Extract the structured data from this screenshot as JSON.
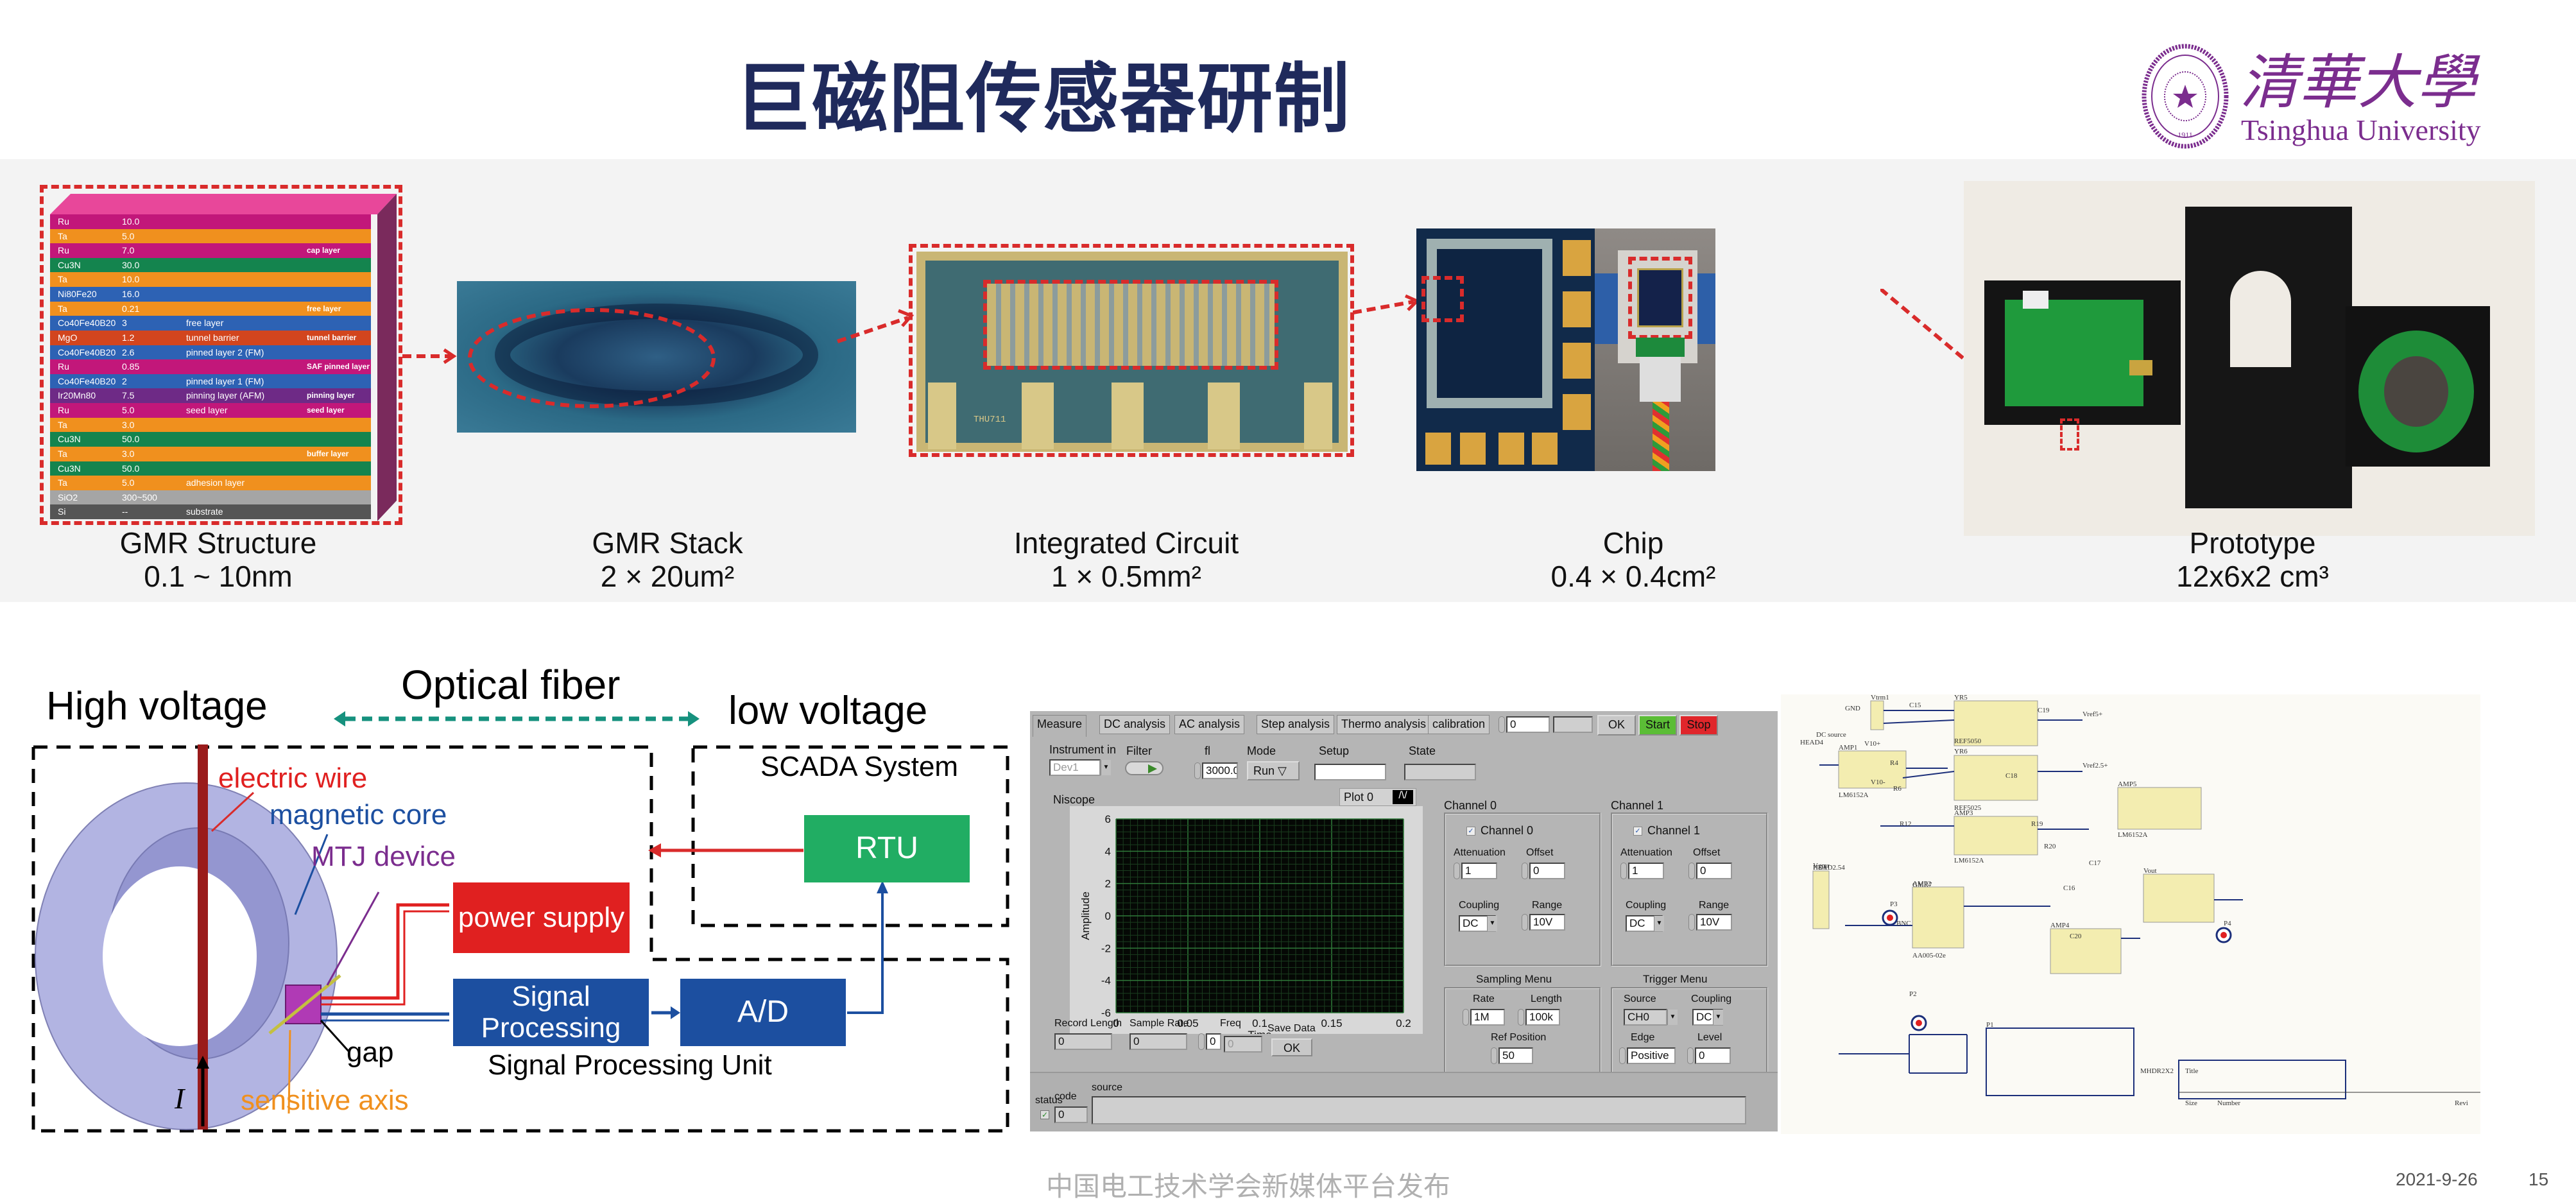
{
  "slide": {
    "title": "巨磁阻传感器研制",
    "logo": {
      "name_cn": "清華大學",
      "name_en": "Tsinghua University",
      "seal_year": "1911",
      "seal_text": "TSINGHUA UNIVERSITY"
    },
    "brand_color": "#1f2a5c",
    "logo_color": "#7b2d8e",
    "accent_red": "#d92b2b",
    "footer": "中国电工技术学会新媒体平台发布",
    "date": "2021-9-26",
    "page_number": "15"
  },
  "gmr_structure": {
    "layers": [
      {
        "material": "Ru",
        "thickness": "10.0",
        "desc": "",
        "color": "#c2177a"
      },
      {
        "material": "Ta",
        "thickness": "5.0",
        "desc": "",
        "color": "#f0901e"
      },
      {
        "material": "Ru",
        "thickness": "7.0",
        "desc": "",
        "color": "#c2177a"
      },
      {
        "material": "Cu3N",
        "thickness": "30.0",
        "desc": "",
        "color": "#14844e"
      },
      {
        "material": "Ta",
        "thickness": "10.0",
        "desc": "",
        "color": "#f0901e"
      },
      {
        "material": "Ni80Fe20",
        "thickness": "16.0",
        "desc": "",
        "color": "#2d62b4"
      },
      {
        "material": "Ta",
        "thickness": "0.21",
        "desc": "",
        "color": "#f0901e"
      },
      {
        "material": "Co40Fe40B20",
        "thickness": "3",
        "desc": "free layer",
        "color": "#2d62b4"
      },
      {
        "material": "MgO",
        "thickness": "1.2",
        "desc": "tunnel barrier",
        "color": "#d2451e"
      },
      {
        "material": "Co40Fe40B20",
        "thickness": "2.6",
        "desc": "pinned layer 2 (FM)",
        "color": "#2d62b4"
      },
      {
        "material": "Ru",
        "thickness": "0.85",
        "desc": "",
        "color": "#c2177a"
      },
      {
        "material": "Co40Fe40B20",
        "thickness": "2",
        "desc": "pinned layer 1 (FM)",
        "color": "#2d62b4"
      },
      {
        "material": "Ir20Mn80",
        "thickness": "7.5",
        "desc": "pinning layer (AFM)",
        "color": "#6e2a86"
      },
      {
        "material": "Ru",
        "thickness": "5.0",
        "desc": "seed layer",
        "color": "#c2177a"
      },
      {
        "material": "Ta",
        "thickness": "3.0",
        "desc": "",
        "color": "#f0901e"
      },
      {
        "material": "Cu3N",
        "thickness": "50.0",
        "desc": "",
        "color": "#14844e"
      },
      {
        "material": "Ta",
        "thickness": "3.0",
        "desc": "",
        "color": "#f0901e"
      },
      {
        "material": "Cu3N",
        "thickness": "50.0",
        "desc": "",
        "color": "#14844e"
      },
      {
        "material": "Ta",
        "thickness": "5.0",
        "desc": "adhesion layer",
        "color": "#f0901e"
      },
      {
        "material": "SiO2",
        "thickness": "300~500",
        "desc": "",
        "color": "#a5a5a5"
      },
      {
        "material": "Si",
        "thickness": "--",
        "desc": "substrate",
        "color": "#555555"
      }
    ],
    "groups": [
      {
        "label": "cap layer",
        "row": 2
      },
      {
        "label": "free layer",
        "row": 6
      },
      {
        "label": "tunnel barrier",
        "row": 8
      },
      {
        "label": "SAF pinned layer",
        "row": 10
      },
      {
        "label": "pinning layer",
        "row": 12
      },
      {
        "label": "seed layer",
        "row": 13
      },
      {
        "label": "buffer layer",
        "row": 16
      }
    ]
  },
  "stages": [
    {
      "title": "GMR Structure",
      "size": "0.1 ~ 10nm"
    },
    {
      "title": "GMR Stack",
      "size": "2 × 20um²"
    },
    {
      "title": "Integrated Circuit",
      "size": "1 × 0.5mm²"
    },
    {
      "title": "Chip",
      "size": "0.4 × 0.4cm²"
    },
    {
      "title": "Prototype",
      "size": "12x6x2 cm³"
    }
  ],
  "ic_marking": "THU711",
  "system_diagram": {
    "high_voltage": "High voltage",
    "optical_fiber": "Optical fiber",
    "low_voltage": "low voltage",
    "scada": "SCADA System",
    "electric_wire": "electric wire",
    "magnetic_core": "magnetic core",
    "mtj_device": "MTJ device",
    "power_supply": "power supply",
    "signal_processing": "Signal Processing",
    "ad": "A/D",
    "rtu": "RTU",
    "gap": "gap",
    "spu": "Signal Processing Unit",
    "sensitive_axis": "sensitive axis",
    "current_symbol": "I"
  },
  "labview": {
    "tabs": [
      "Measure",
      "DC analysis",
      "AC analysis",
      "Step analysis",
      "Thermo analysis",
      "calibration"
    ],
    "tab_numeric": "0",
    "ok": "OK",
    "start": "Start",
    "stop": "Stop",
    "instrument_label": "Instrument in",
    "instrument_value": "Dev1",
    "filter_label": "Filter",
    "fl_label": "fl",
    "fl_value": "3000.0",
    "mode_label": "Mode",
    "mode_value": "Run",
    "setup_label": "Setup",
    "state_label": "State",
    "scope_label": "Niscope",
    "plot_legend": "Plot 0",
    "channels": [
      {
        "title": "Channel 0",
        "check": "Channel 0",
        "attenuation": "1",
        "offset": "0",
        "coupling": "DC",
        "range": "10V"
      },
      {
        "title": "Channel 1",
        "check": "Channel 1",
        "attenuation": "1",
        "offset": "0",
        "coupling": "DC",
        "range": "10V"
      }
    ],
    "labels": {
      "attenuation": "Attenuation",
      "offset": "Offset",
      "coupling": "Coupling",
      "range": "Range"
    },
    "sampling": {
      "title": "Sampling Menu",
      "rate_label": "Rate",
      "rate": "1M",
      "length_label": "Length",
      "length": "100k",
      "ref_label": "Ref Position",
      "ref": "50"
    },
    "trigger": {
      "title": "Trigger Menu",
      "source_label": "Source",
      "source": "CH0",
      "coupling_label": "Coupling",
      "coupling": "DC",
      "edge_label": "Edge",
      "edge": "Positive",
      "level_label": "Level",
      "level": "0"
    },
    "record_length_label": "Record Length",
    "record_length": "0",
    "sample_rate_label": "Sample Rate",
    "sample_rate": "0",
    "freq_label": "Freq",
    "freq_ctrl": "0",
    "freq": "0",
    "save_label": "Save Data",
    "save_button": "OK",
    "status_label": "status",
    "code_label": "code",
    "code": "0",
    "source_label": "source"
  },
  "chart_data": {
    "type": "line",
    "title": "Niscope",
    "xlabel": "Time",
    "ylabel": "Amplitude",
    "xlim": [
      0,
      0.2
    ],
    "ylim": [
      -6,
      6
    ],
    "x_ticks": [
      "0",
      "0.05",
      "0.1",
      "0.15",
      "0.2"
    ],
    "y_ticks": [
      "6",
      "4",
      "2",
      "0",
      "-2",
      "-4",
      "-6"
    ],
    "grid": true,
    "legend": "top-right",
    "series": [
      {
        "name": "Plot 0",
        "values": []
      }
    ]
  },
  "schematic": {
    "labels": [
      "YR5",
      "REF5050",
      "YR6",
      "REF5025",
      "AMP1",
      "LM6152A",
      "AMP3",
      "LM6152A",
      "AMP5",
      "LM6152A",
      "AMP2",
      "AMP4",
      "Vtrm1",
      "HEAD2.54",
      "HEAD4",
      "DC source",
      "Vgmr",
      "Vout",
      "HD1",
      "GMR7",
      "AA005-02e",
      "P1",
      "MHDR2X2",
      "P2",
      "P3",
      "P4",
      "BNC",
      "C15",
      "C16",
      "C17",
      "C18",
      "C19",
      "C20",
      "R4",
      "R6",
      "R12",
      "R19",
      "R20",
      "GND",
      "V10+",
      "V10-",
      "Vref5+",
      "Vref2.5+"
    ],
    "title_block": {
      "title": "Title",
      "size": "Size",
      "number": "Number",
      "revision": "Revi"
    }
  }
}
